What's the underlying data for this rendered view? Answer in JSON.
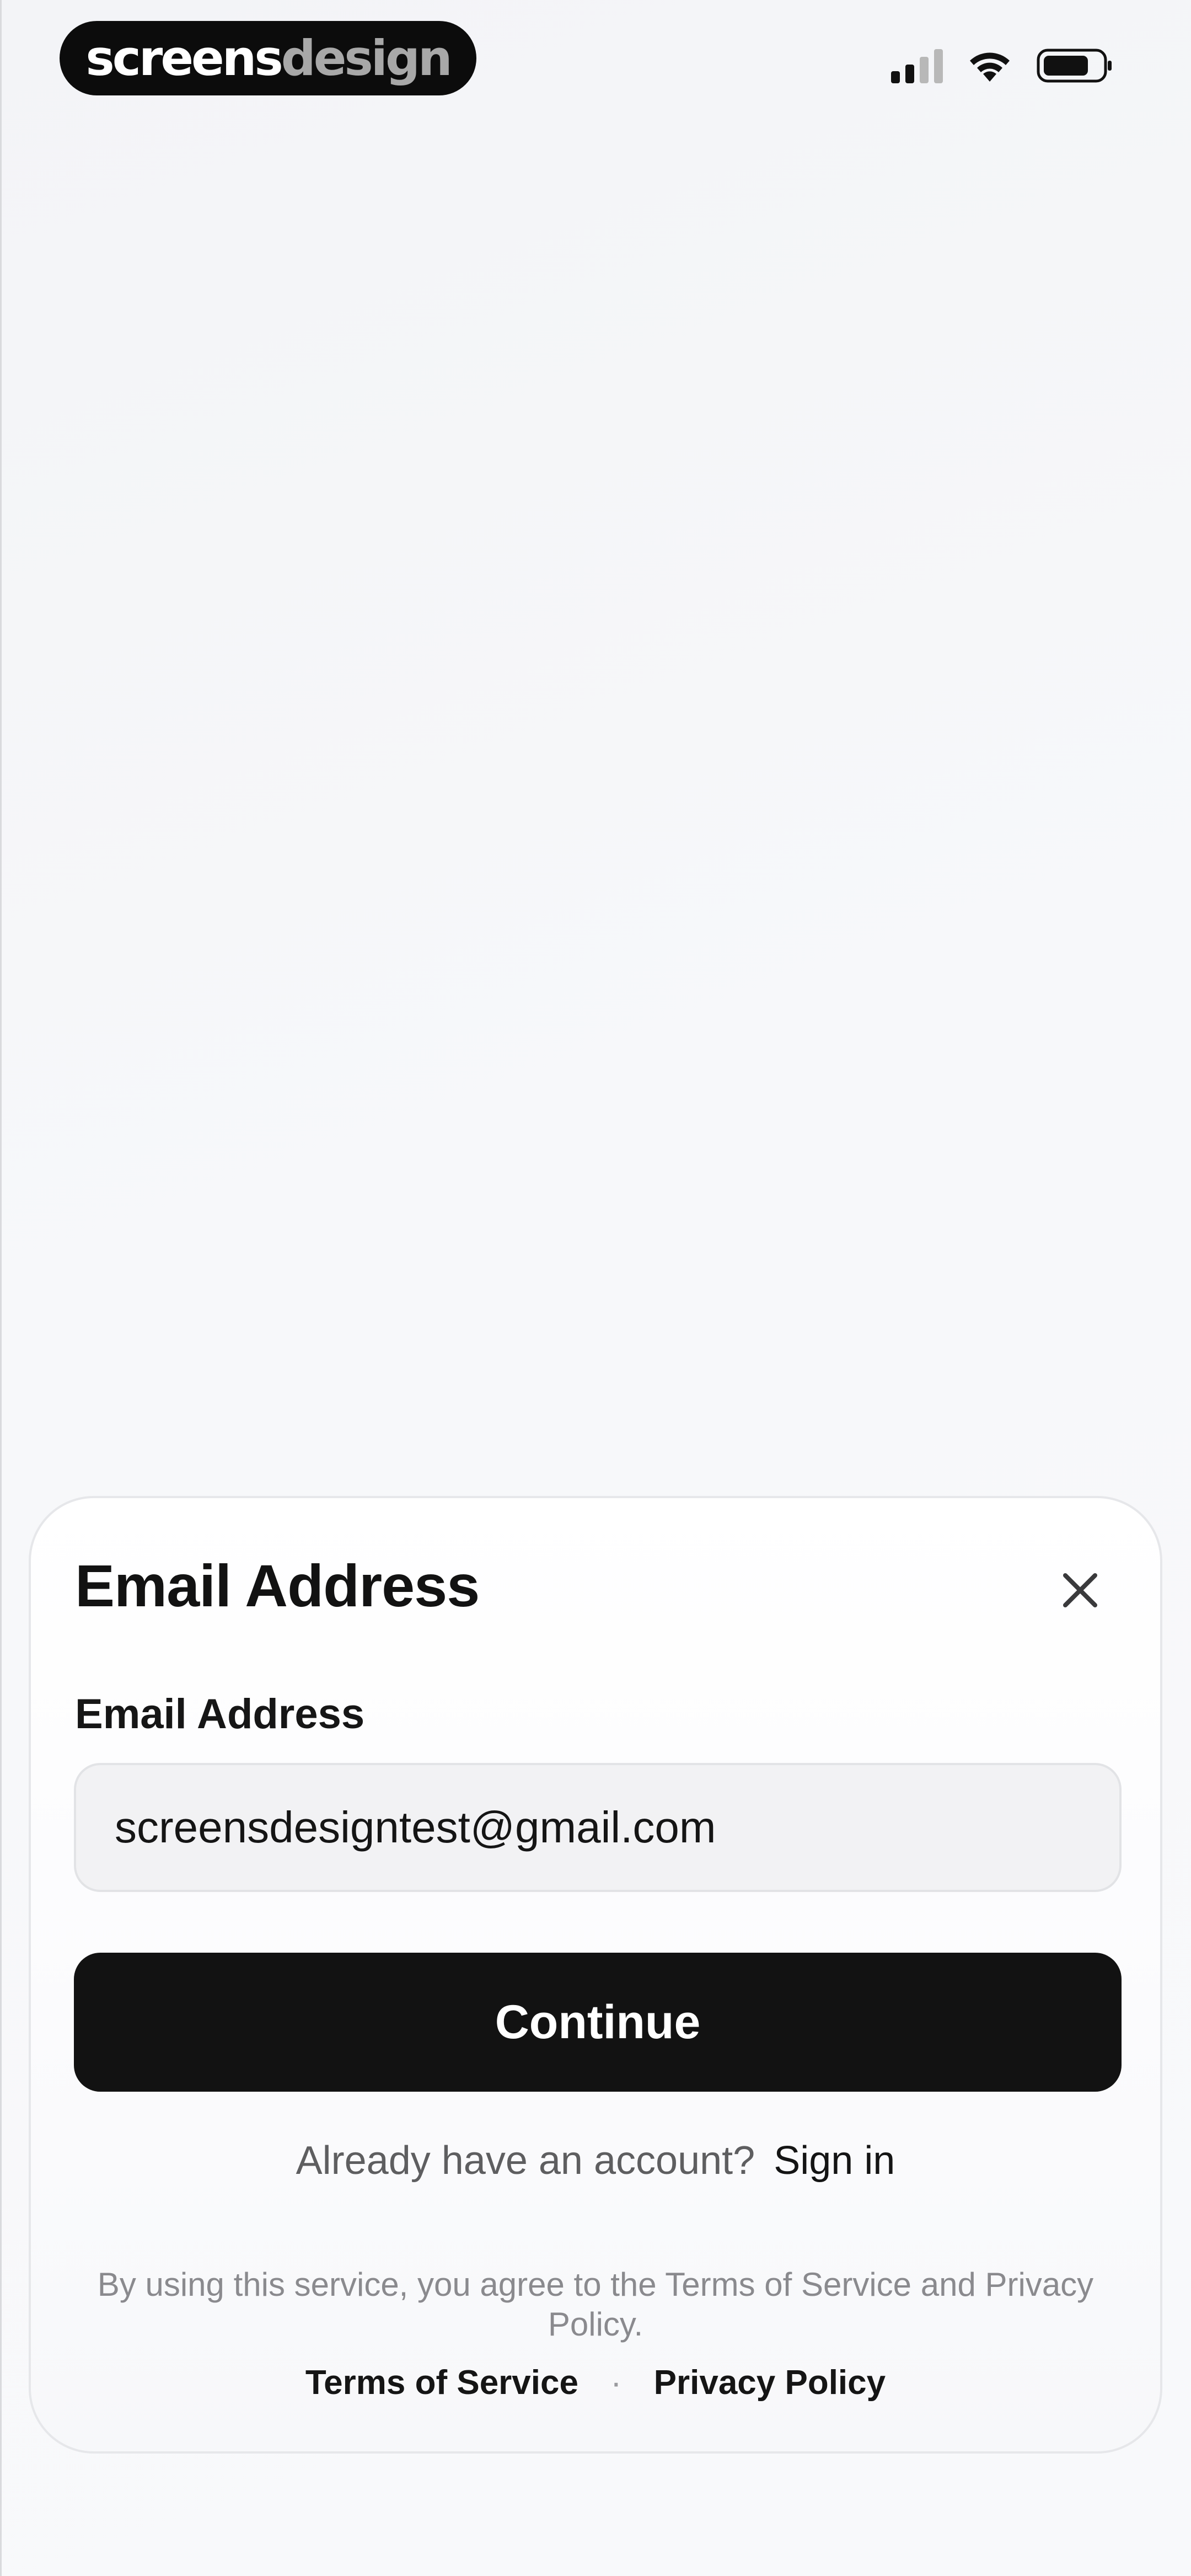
{
  "status_bar": {
    "brand_word_1": "screens",
    "brand_word_2": "design",
    "icons": [
      "cellular-signal-icon",
      "wifi-icon",
      "battery-icon"
    ]
  },
  "sheet": {
    "title": "Email Address",
    "close_icon": "close-icon",
    "field_label": "Email Address",
    "email_value": "screensdesigntest@gmail.com",
    "continue_label": "Continue",
    "account_question": "Already have an account?",
    "sign_in_label": "Sign in",
    "legal_text": "By using this service, you agree to the Terms of Service and Privacy Policy.",
    "terms_label": "Terms of Service",
    "separator": "·",
    "privacy_label": "Privacy Policy"
  },
  "colors": {
    "primary_button": "#121212",
    "input_background": "#f2f2f4",
    "muted_text": "#8a8a8e"
  }
}
